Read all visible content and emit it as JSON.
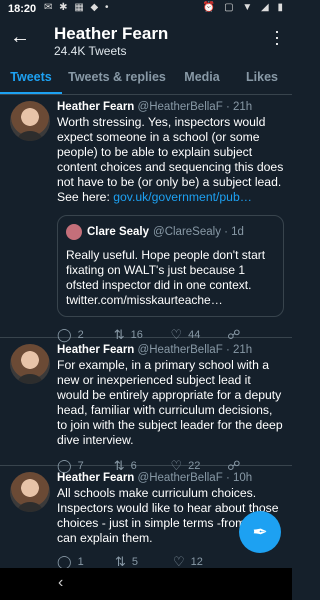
{
  "statusbar": {
    "time": "18:20",
    "notifications": "✉ ✱ ▦ ◆ •",
    "system_icons": "⏰ ▢ ▼ ◢ ▮"
  },
  "header": {
    "title": "Heather Fearn",
    "subtitle": "24.4K Tweets"
  },
  "tabs": [
    {
      "label": "Tweets",
      "active": true
    },
    {
      "label": "Tweets & replies",
      "active": false
    },
    {
      "label": "Media",
      "active": false
    },
    {
      "label": "Likes",
      "active": false
    }
  ],
  "tweets": [
    {
      "name": "Heather Fearn",
      "handle": "@HeatherBellaF",
      "time": "· 21h",
      "text": "Worth stressing. Yes, inspectors would expect someone in a school  (or some people) to be able to explain subject content choices and sequencing this does not have to be (or only be) a subject lead. See here: ",
      "link": "gov.uk/government/pub…",
      "quote": {
        "name": "Clare Sealy",
        "handle": "@ClareSealy · 1d",
        "text": "Really useful. Hope people don't start fixating on WALT's just because 1 ofsted inspector did in one context. twitter.com/misskaurteache…"
      },
      "actions": {
        "replies": "2",
        "retweets": "16",
        "likes": "44"
      }
    },
    {
      "name": "Heather Fearn",
      "handle": "@HeatherBellaF",
      "time": "· 21h",
      "text": "For example, in a primary school with a new or inexperienced subject lead it would be entirely appropriate for a deputy head, familiar with curriculum decisions, to join with the subject leader for the deep dive interview.",
      "actions": {
        "replies": "7",
        "retweets": "6",
        "likes": "22"
      }
    },
    {
      "name": "Heather Fearn",
      "handle": "@HeatherBellaF",
      "time": "· 10h",
      "text": "All schools make curriculum choices. Inspectors would like to hear about those choices - just in simple terms -from wh... can explain them.",
      "actions": {
        "replies": "1",
        "retweets": "5",
        "likes": "12"
      }
    }
  ],
  "icons": {
    "back": "arrow-left-icon",
    "more": "more-vertical-icon",
    "reply": "reply-icon",
    "retweet": "retweet-icon",
    "like": "heart-icon",
    "share": "share-icon",
    "compose": "compose-feather-icon"
  },
  "colors": {
    "background": "#15202b",
    "accent": "#1da1f2",
    "muted": "#8899a6",
    "divider": "#38444d"
  }
}
